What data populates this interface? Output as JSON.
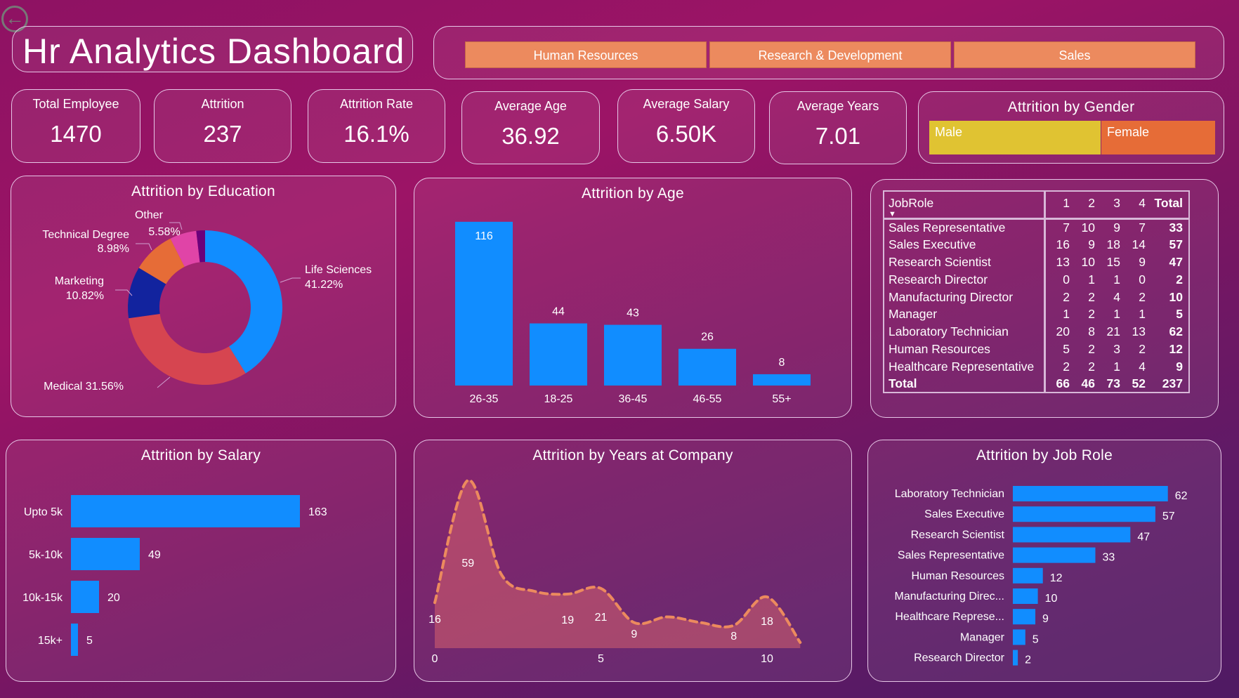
{
  "header": {
    "title": "Hr Analytics Dashboard",
    "back_icon": "arrow-left-circle-icon"
  },
  "departments": [
    "Human Resources",
    "Research & Development",
    "Sales"
  ],
  "kpis": [
    {
      "label": "Total Employee",
      "value": "1470"
    },
    {
      "label": "Attrition",
      "value": "237"
    },
    {
      "label": "Attrition Rate",
      "value": "16.1%"
    },
    {
      "label": "Average Age",
      "value": "36.92"
    },
    {
      "label": "Average Salary",
      "value": "6.50K"
    },
    {
      "label": "Average Years",
      "value": "7.01"
    }
  ],
  "gender": {
    "title": "Attrition by Gender",
    "male": "Male",
    "female": "Female",
    "male_color": "#E0C332",
    "female_color": "#E66C37"
  },
  "colors": {
    "bar": "#118DFF",
    "accent": "#EC8A5E"
  },
  "table": {
    "headers": [
      "JobRole",
      "1",
      "2",
      "3",
      "4",
      "Total"
    ],
    "rows": [
      [
        "Sales Representative",
        "7",
        "10",
        "9",
        "7",
        "33"
      ],
      [
        "Sales Executive",
        "16",
        "9",
        "18",
        "14",
        "57"
      ],
      [
        "Research Scientist",
        "13",
        "10",
        "15",
        "9",
        "47"
      ],
      [
        "Research Director",
        "0",
        "1",
        "1",
        "0",
        "2"
      ],
      [
        "Manufacturing Director",
        "2",
        "2",
        "4",
        "2",
        "10"
      ],
      [
        "Manager",
        "1",
        "2",
        "1",
        "1",
        "5"
      ],
      [
        "Laboratory Technician",
        "20",
        "8",
        "21",
        "13",
        "62"
      ],
      [
        "Human Resources",
        "5",
        "2",
        "3",
        "2",
        "12"
      ],
      [
        "Healthcare Representative",
        "2",
        "2",
        "1",
        "4",
        "9"
      ]
    ],
    "total": [
      "Total",
      "66",
      "46",
      "73",
      "52",
      "237"
    ]
  },
  "chart_data": [
    {
      "id": "education",
      "type": "pie",
      "title": "Attrition by Education",
      "donut": true,
      "slices": [
        {
          "name": "Life Sciences",
          "value": 41.22,
          "label": "41.22%",
          "color": "#118DFF"
        },
        {
          "name": "Medical",
          "value": 31.56,
          "label": "31.56%",
          "color": "#D64550"
        },
        {
          "name": "Marketing",
          "value": 10.82,
          "label": "10.82%",
          "color": "#12239E"
        },
        {
          "name": "Technical Degree",
          "value": 8.98,
          "label": "8.98%",
          "color": "#E66C37"
        },
        {
          "name": "Other",
          "value": 5.58,
          "label": "5.58%",
          "color": "#E044A7"
        },
        {
          "name": "",
          "value": 1.84,
          "label": "",
          "color": "#6B007B"
        }
      ]
    },
    {
      "id": "age",
      "type": "bar",
      "title": "Attrition by Age",
      "categories": [
        "26-35",
        "18-25",
        "36-45",
        "46-55",
        "55+"
      ],
      "values": [
        116,
        44,
        43,
        26,
        8
      ]
    },
    {
      "id": "salary",
      "type": "bar",
      "orientation": "horizontal",
      "title": "Attrition by Salary",
      "categories": [
        "Upto 5k",
        "5k-10k",
        "10k-15k",
        "15k+"
      ],
      "values": [
        163,
        49,
        20,
        5
      ]
    },
    {
      "id": "years",
      "type": "area",
      "title": "Attrition by Years at Company",
      "x": [
        0,
        1,
        2,
        3,
        4,
        5,
        6,
        7,
        8,
        9,
        10,
        11
      ],
      "values": [
        16,
        59,
        26,
        20,
        19,
        21,
        9,
        11,
        9,
        8,
        18,
        2
      ],
      "labeled": [
        0,
        1,
        4,
        5,
        6,
        9,
        10
      ],
      "xticks": [
        "0",
        "5",
        "10"
      ]
    },
    {
      "id": "jobrole",
      "type": "bar",
      "orientation": "horizontal",
      "title": "Attrition by Job Role",
      "categories": [
        "Laboratory Technician",
        "Sales Executive",
        "Research Scientist",
        "Sales Representative",
        "Human Resources",
        "Manufacturing Direc...",
        "Healthcare Represe...",
        "Manager",
        "Research Director"
      ],
      "values": [
        62,
        57,
        47,
        33,
        12,
        10,
        9,
        5,
        2
      ]
    }
  ]
}
